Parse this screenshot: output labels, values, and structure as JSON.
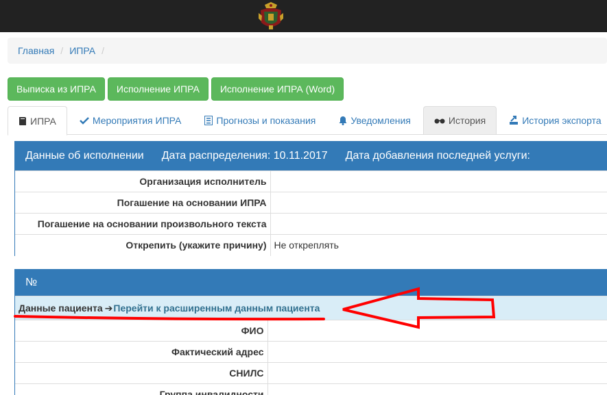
{
  "colors": {
    "topbar": "#222222",
    "primary": "#337ab7",
    "success": "#5cb85c",
    "info_bg": "#d9edf7",
    "annotation": "#ff0000"
  },
  "breadcrumb": {
    "items": [
      "Главная",
      "ИПРА"
    ],
    "separator": "/"
  },
  "buttons": {
    "extract": "Выписка из ИПРА",
    "execution": "Исполнение ИПРА",
    "execution_word": "Исполнение ИПРА (Word)"
  },
  "tabs": [
    {
      "label": "ИПРА",
      "icon": "book-icon"
    },
    {
      "label": "Мероприятия ИПРА",
      "icon": "check-icon"
    },
    {
      "label": "Прогнозы и показания",
      "icon": "list-icon"
    },
    {
      "label": "Уведомления",
      "icon": "bell-icon"
    },
    {
      "label": "История",
      "icon": "glasses-icon"
    },
    {
      "label": "История экспорта",
      "icon": "export-icon"
    }
  ],
  "execution_panel": {
    "title": "Данные об исполнении",
    "distribution_date_label": "Дата распределения:",
    "distribution_date": "10.11.2017",
    "last_service_label": "Дата добавления последней услуги:",
    "rows": [
      {
        "label": "Организация исполнитель",
        "value": ""
      },
      {
        "label": "Погашение на основании ИПРА",
        "value": ""
      },
      {
        "label": "Погашение на основании произвольного текста",
        "value": ""
      },
      {
        "label": "Открепить (укажите причину)",
        "value": "Не откреплять"
      }
    ]
  },
  "patient_panel": {
    "title": "№",
    "patient_data_label": "Данные пациента",
    "arrow": "➔",
    "extended_link": "Перейти к расширенным данным пациента",
    "rows": [
      {
        "label": "ФИО",
        "value": ""
      },
      {
        "label": "Фактический адрес",
        "value": ""
      },
      {
        "label": "СНИЛС",
        "value": ""
      },
      {
        "label": "Группа инвалидности",
        "value": ""
      }
    ]
  }
}
